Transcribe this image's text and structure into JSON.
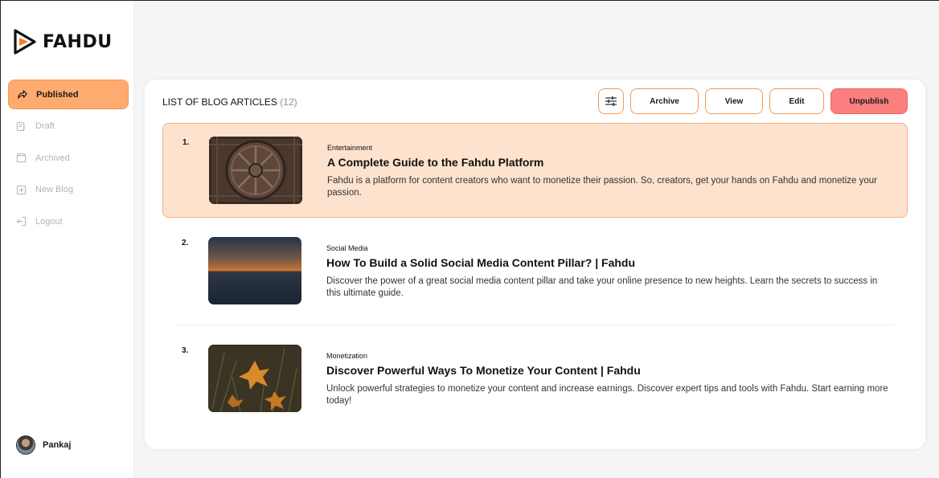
{
  "brand": {
    "name": "FAHDU",
    "accent": "#ffab70",
    "danger": "#fb7f7f"
  },
  "sidebar": {
    "items": [
      {
        "label": "Published",
        "icon": "share-arrow-icon",
        "active": true
      },
      {
        "label": "Draft",
        "icon": "draft-edit-icon",
        "active": false
      },
      {
        "label": "Archived",
        "icon": "archive-box-icon",
        "active": false
      },
      {
        "label": "New Blog",
        "icon": "plus-square-icon",
        "active": false
      },
      {
        "label": "Logout",
        "icon": "logout-icon",
        "active": false
      }
    ],
    "user": {
      "name": "Pankaj"
    }
  },
  "main": {
    "heading": "LIST OF BLOG ARTICLES",
    "count": "(12)",
    "toolbar": {
      "filter_icon": "sliders-icon",
      "archive_label": "Archive",
      "view_label": "View",
      "edit_label": "Edit",
      "unpublish_label": "Unpublish"
    },
    "articles": [
      {
        "number": "1.",
        "category": "Entertainment",
        "title": "A Complete Guide to the Fahdu Platform",
        "description": "Fahdu is a platform for content creators who want to monetize their passion. So, creators, get your hands on Fahdu and monetize your passion.",
        "selected": true
      },
      {
        "number": "2.",
        "category": "Social Media",
        "title": "How To Build a Solid Social Media Content Pillar? | Fahdu",
        "description": "Discover the power of a great social media content pillar and take your online presence to new heights. Learn the secrets to success in this ultimate guide.",
        "selected": false
      },
      {
        "number": "3.",
        "category": "Monetization",
        "title": "Discover Powerful Ways To Monetize Your Content | Fahdu",
        "description": "Unlock powerful strategies to monetize your content and increase earnings. Discover expert tips and tools with Fahdu. Start earning more today!",
        "selected": false
      }
    ]
  }
}
